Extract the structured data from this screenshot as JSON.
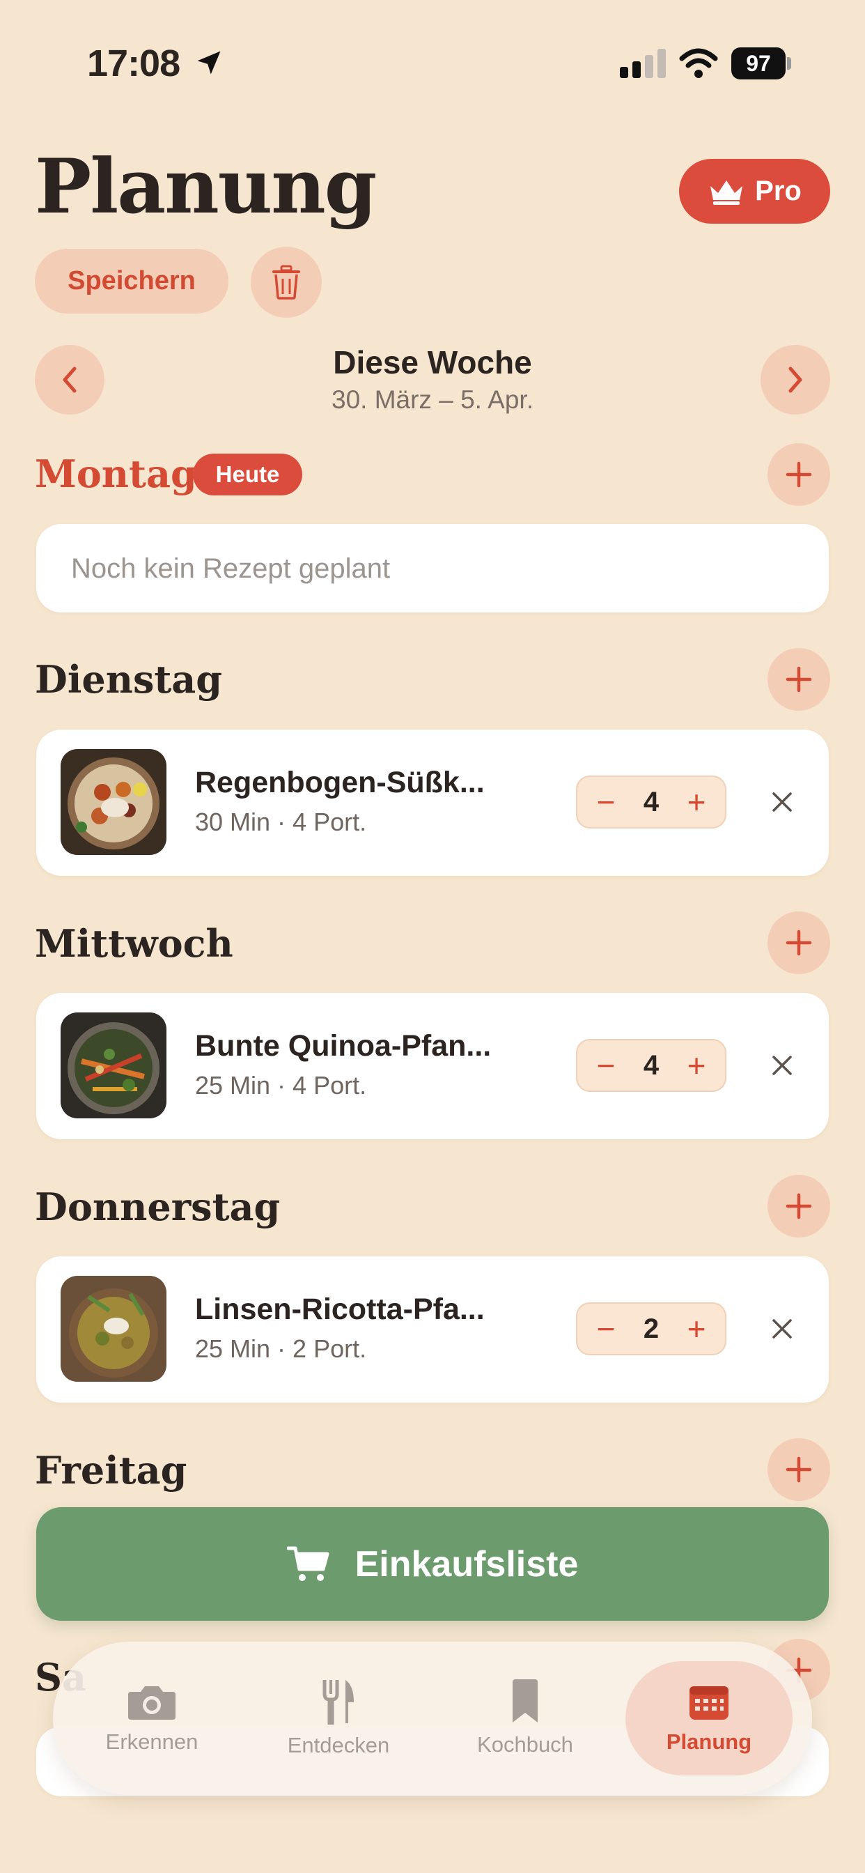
{
  "status": {
    "time": "17:08",
    "battery": "97"
  },
  "header": {
    "title": "Planung",
    "pro_label": "Pro",
    "save_label": "Speichern"
  },
  "week": {
    "title": "Diese Woche",
    "range": "30. März – 5. Apr."
  },
  "today_badge": "Heute",
  "days": [
    {
      "label": "Montag",
      "empty_text": "Noch kein Rezept geplant"
    },
    {
      "label": "Dienstag",
      "recipe": {
        "name": "Regenbogen-Süßk...",
        "meta": "30 Min · 4 Port.",
        "servings": "4"
      }
    },
    {
      "label": "Mittwoch",
      "recipe": {
        "name": "Bunte Quinoa-Pfan...",
        "meta": "25 Min · 4 Port.",
        "servings": "4"
      }
    },
    {
      "label": "Donnerstag",
      "recipe": {
        "name": "Linsen-Ricotta-Pfa...",
        "meta": "25 Min · 2 Port.",
        "servings": "2"
      }
    },
    {
      "label": "Freitag"
    },
    {
      "label": "Sa"
    }
  ],
  "shopping_label": "Einkaufsliste",
  "tabs": [
    {
      "label": "Erkennen",
      "icon": "camera-icon"
    },
    {
      "label": "Entdecken",
      "icon": "fork-knife-icon"
    },
    {
      "label": "Kochbuch",
      "icon": "bookmark-icon"
    },
    {
      "label": "Planung",
      "icon": "calendar-icon"
    }
  ],
  "colors": {
    "background": "#f6e6cf",
    "accent": "#dc4c3c",
    "green": "#6c9c6e"
  }
}
